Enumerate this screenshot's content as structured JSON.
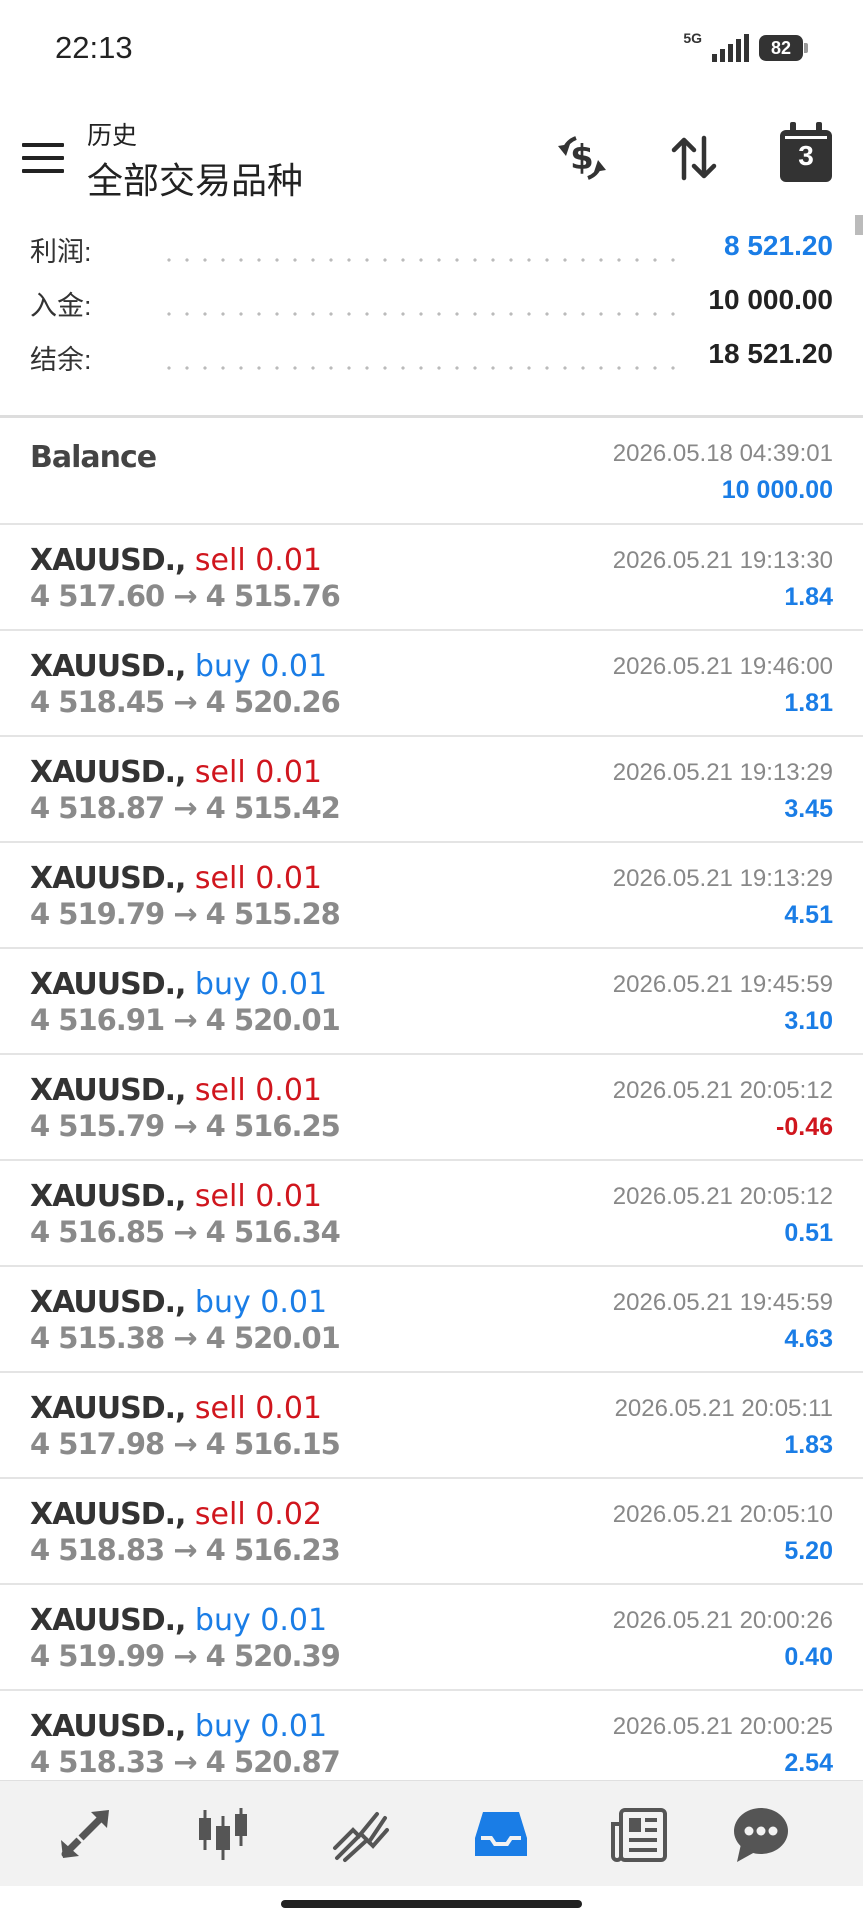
{
  "status_bar": {
    "time": "22:13",
    "network": "5G",
    "battery": "82"
  },
  "header": {
    "subtitle": "历史",
    "title": "全部交易品种",
    "calendar_number": "3"
  },
  "summary": [
    {
      "label": "利润:",
      "value": "8 521.20",
      "color": "#1a7de6"
    },
    {
      "label": "入金:",
      "value": "10 000.00",
      "color": "#222222"
    },
    {
      "label": "结余:",
      "value": "18 521.20",
      "color": "#222222"
    }
  ],
  "balance": {
    "title": "Balance",
    "time": "2026.05.18 04:39:01",
    "amount": "10 000.00"
  },
  "deals": [
    {
      "symbol": "XAUUSD.,",
      "side": "sell",
      "volume": "sell 0.01",
      "prices": "4 517.60 → 4 515.76",
      "time": "2026.05.21 19:13:30",
      "profit": "1.84"
    },
    {
      "symbol": "XAUUSD.,",
      "side": "buy",
      "volume": "buy 0.01",
      "prices": "4 518.45 → 4 520.26",
      "time": "2026.05.21 19:46:00",
      "profit": "1.81"
    },
    {
      "symbol": "XAUUSD.,",
      "side": "sell",
      "volume": "sell 0.01",
      "prices": "4 518.87 → 4 515.42",
      "time": "2026.05.21 19:13:29",
      "profit": "3.45"
    },
    {
      "symbol": "XAUUSD.,",
      "side": "sell",
      "volume": "sell 0.01",
      "prices": "4 519.79 → 4 515.28",
      "time": "2026.05.21 19:13:29",
      "profit": "4.51"
    },
    {
      "symbol": "XAUUSD.,",
      "side": "buy",
      "volume": "buy 0.01",
      "prices": "4 516.91 → 4 520.01",
      "time": "2026.05.21 19:45:59",
      "profit": "3.10"
    },
    {
      "symbol": "XAUUSD.,",
      "side": "sell",
      "volume": "sell 0.01",
      "prices": "4 515.79 → 4 516.25",
      "time": "2026.05.21 20:05:12",
      "profit": "-0.46"
    },
    {
      "symbol": "XAUUSD.,",
      "side": "sell",
      "volume": "sell 0.01",
      "prices": "4 516.85 → 4 516.34",
      "time": "2026.05.21 20:05:12",
      "profit": "0.51"
    },
    {
      "symbol": "XAUUSD.,",
      "side": "buy",
      "volume": "buy 0.01",
      "prices": "4 515.38 → 4 520.01",
      "time": "2026.05.21 19:45:59",
      "profit": "4.63"
    },
    {
      "symbol": "XAUUSD.,",
      "side": "sell",
      "volume": "sell 0.01",
      "prices": "4 517.98 → 4 516.15",
      "time": "2026.05.21 20:05:11",
      "profit": "1.83"
    },
    {
      "symbol": "XAUUSD.,",
      "side": "sell",
      "volume": "sell 0.02",
      "prices": "4 518.83 → 4 516.23",
      "time": "2026.05.21 20:05:10",
      "profit": "5.20"
    },
    {
      "symbol": "XAUUSD.,",
      "side": "buy",
      "volume": "buy 0.01",
      "prices": "4 519.99 → 4 520.39",
      "time": "2026.05.21 20:00:26",
      "profit": "0.40"
    },
    {
      "symbol": "XAUUSD.,",
      "side": "buy",
      "volume": "buy 0.01",
      "prices": "4 518.33 → 4 520.87",
      "time": "2026.05.21 20:00:25",
      "profit": "2.54"
    }
  ],
  "colors": {
    "profit": "#1a7de6",
    "loss": "#d0161e",
    "buy": "#1a7de6",
    "sell": "#d0161e",
    "active_nav": "#1a7de6"
  },
  "nav": [
    {
      "icon": "trade-arrows-icon",
      "active": false
    },
    {
      "icon": "candlestick-icon",
      "active": false
    },
    {
      "icon": "chart-lines-icon",
      "active": false
    },
    {
      "icon": "history-inbox-icon",
      "active": true
    },
    {
      "icon": "news-icon",
      "active": false
    },
    {
      "icon": "chat-icon",
      "active": false
    }
  ]
}
